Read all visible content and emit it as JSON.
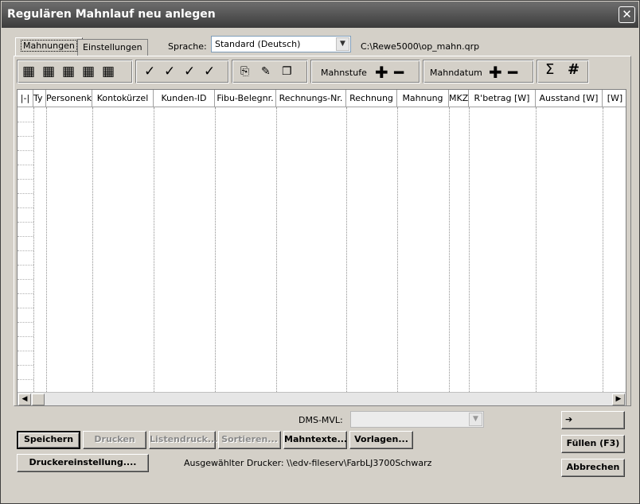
{
  "window": {
    "title": "Regulären Mahnlauf neu anlegen"
  },
  "tabs": [
    {
      "label": "Mahnungen",
      "active": true
    },
    {
      "label": "Einstellungen",
      "active": false
    }
  ],
  "sprache": {
    "label": "Sprache:",
    "value": "Standard (Deutsch)"
  },
  "path": "C:\\Rewe5000\\op_mahn.qrp",
  "toolbar": {
    "grid_icons": [
      "grid-icon-1",
      "grid-icon-2",
      "grid-icon-3",
      "grid-icon-4",
      "grid-icon-5"
    ],
    "check_icons": [
      "check-icon-1",
      "check-icon-2",
      "check-icon-3",
      "check-icon-4"
    ],
    "doc_icons": [
      "copy-icon",
      "edit-doc-icon",
      "preview-doc-icon"
    ],
    "mahnstufe_label": "Mahnstufe",
    "mahndatum_label": "Mahndatum",
    "plus": "✚",
    "minus": "━",
    "sigma": "Σ",
    "hash": "#"
  },
  "grid": {
    "columns": [
      "|-|",
      "Ty",
      "Personenk",
      "Kontokürzel",
      "Kunden-ID",
      "Fibu-Belegnr.",
      "Rechnungs-Nr.",
      "Rechnung",
      "Mahnung",
      "MKZ",
      "R'betrag [W]",
      "Ausstand [W]",
      "[W]"
    ]
  },
  "dms": {
    "label": "DMS-MVL:",
    "value": ""
  },
  "buttons": {
    "speichern": "Speichern",
    "drucken": "Drucken",
    "listendruck": "Listendruck...",
    "sortieren": "Sortieren...",
    "mahntexte": "Mahntexte...",
    "vorlagen": "Vorlagen...",
    "druckereinstellung": "Druckereinstellung....",
    "arrow": "➔",
    "fuellen": "Füllen (F3)",
    "abbrechen": "Abbrechen"
  },
  "printer": "Ausgewählter Drucker: \\\\edv-fileserv\\FarbLJ3700Schwarz"
}
